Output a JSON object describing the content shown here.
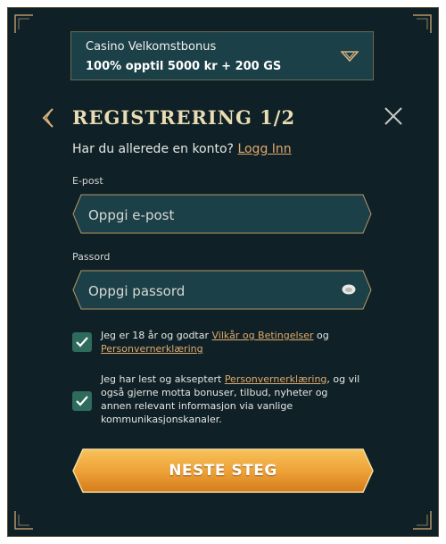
{
  "colors": {
    "background": "#0f2127",
    "panel": "#1c4048",
    "gold_accent": "#e0a86b",
    "heading": "#e9dcb2",
    "checkbox": "#2e6b5c",
    "button_top": "#f3b44a",
    "button_bottom": "#d98320"
  },
  "bonus": {
    "title": "Casino Velkomstbonus",
    "value": "100% opptil 5000 kr + 200 GS",
    "icon": "chevron-down-icon"
  },
  "header": {
    "title": "REGISTRERING 1/2",
    "back_icon": "chevron-left-icon",
    "close_icon": "close-icon"
  },
  "account": {
    "prompt": "Har du allerede en konto?",
    "login_link": "Logg Inn"
  },
  "email": {
    "label": "E-post",
    "placeholder": "Oppgi e-post",
    "value": ""
  },
  "password": {
    "label": "Passord",
    "placeholder": "Oppgi passord",
    "value": "",
    "icon": "eye-icon"
  },
  "consent1": {
    "checked": true,
    "text_before": "Jeg er 18 år og godtar ",
    "link1": "Vilkår og Betingelser",
    "text_mid": " og",
    "link2": "Personvernerklæring"
  },
  "consent2": {
    "checked": true,
    "text_before": "Jeg har lest og akseptert ",
    "link": "Personvernerklæring",
    "text_after": ", og vil",
    "line2": "også gjerne motta bonuser, tilbud, nyheter og",
    "line3": "annen relevant informasjon via vanlige",
    "line4": "kommunikasjonskanaler."
  },
  "cta": {
    "label": "NESTE STEG"
  }
}
